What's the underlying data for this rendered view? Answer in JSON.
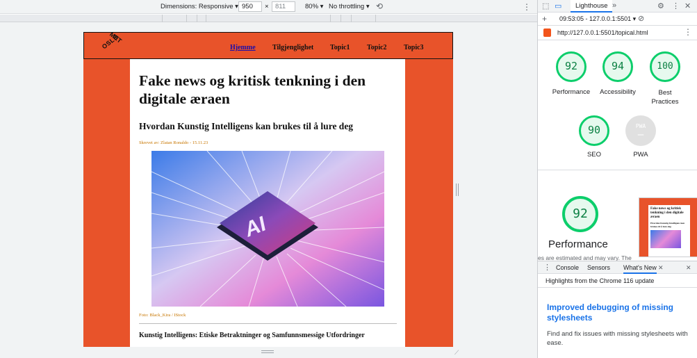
{
  "device_toolbar": {
    "dimensions_label": "Dimensions: Responsive ▾",
    "width": "950",
    "times": "×",
    "height": "811",
    "zoom": "80% ▾",
    "throttling": "No throttling ▾",
    "rotate_icon": "rotate-icon",
    "more_icon": "⋮"
  },
  "site": {
    "logo_left": "OSLO",
    "logo_right": "MET",
    "nav": [
      "Hjemme",
      "Tilgjenglighet",
      "Topic1",
      "Topic2",
      "Topic3"
    ],
    "active_nav": "Hjemme",
    "brand_color": "#e8532a"
  },
  "article": {
    "title": "Fake news og kritisk tenkning i den digitale æraen",
    "subtitle": "Hvordan Kunstig Intelligens kan brukes til å lure deg",
    "byline": "Skrevet av: Zlatan Ronaldo - 15.11.23",
    "image_text": "AI",
    "photo_credit": "Foto: Black_Kira / IStock",
    "section_heading": "Kunstig Intelligens: Etiske Betraktninger og Samfunnsmessige Utfordringer"
  },
  "devtools": {
    "tab_label": "Lighthouse",
    "more_tabs": "»",
    "close": "✕",
    "run_label": "09:53:05 - 127.0.0.1:5501 ▾",
    "url": "http://127.0.0.1:5501/topical.html",
    "scores": [
      {
        "value": "92",
        "label": "Performance"
      },
      {
        "value": "94",
        "label": "Accessibility"
      },
      {
        "value": "100",
        "label": "Best Practices"
      },
      {
        "value": "90",
        "label": "SEO"
      },
      {
        "value": "PWA",
        "label": "PWA"
      }
    ],
    "perf_score": "92",
    "perf_label": "Performance",
    "cut_note": "es are estimated and may vary. The",
    "thumb_title": "Fake news og kritisk tenkning i den digitale æraen",
    "thumb_sub": "Hvordan Kunstig Intelligens kan brukes til å lure deg",
    "drawer_tabs": [
      "Console",
      "Sensors",
      "What's New"
    ],
    "drawer_close": "✕",
    "highlights": "Highlights from the Chrome 116 update",
    "news_title": "Improved debugging of missing stylesheets",
    "news_body": "Find and fix issues with missing stylesheets with ease.",
    "score_color": "#0cce6b",
    "link_color": "#1a73e8"
  }
}
